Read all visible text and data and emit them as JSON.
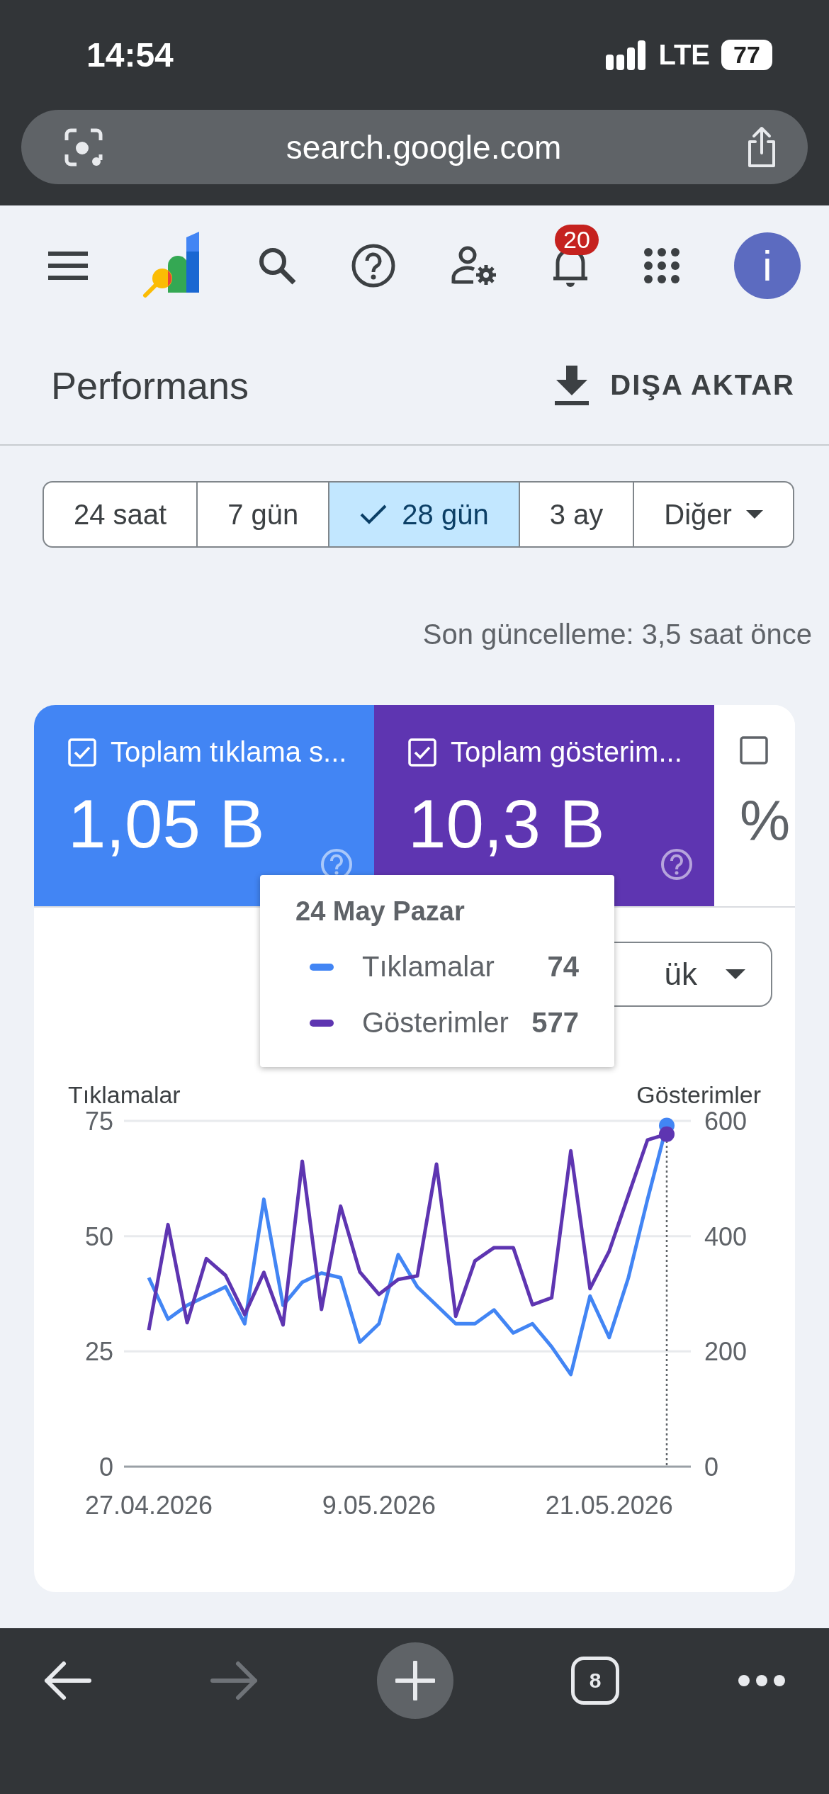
{
  "status_bar": {
    "time": "14:54",
    "network": "LTE",
    "battery": "77"
  },
  "browser": {
    "url": "search.google.com"
  },
  "header": {
    "notifications_badge": "20",
    "avatar_letter": "i"
  },
  "page": {
    "title": "Performans",
    "export_label": "DIŞA AKTAR"
  },
  "ranges": [
    {
      "label": "24 saat",
      "selected": false
    },
    {
      "label": "7 gün",
      "selected": false
    },
    {
      "label": "28 gün",
      "selected": true
    },
    {
      "label": "3 ay",
      "selected": false
    },
    {
      "label": "Diğer",
      "selected": false,
      "kind": "dropdown"
    }
  ],
  "last_update": "Son güncelleme: 3,5 saat önce",
  "metrics": [
    {
      "label": "Toplam tıklama s...",
      "value": "1,05 B",
      "checked": true,
      "color": "#4285f4"
    },
    {
      "label": "Toplam gösterim...",
      "value": "10,3 B",
      "checked": true,
      "color": "#5e35b1"
    },
    {
      "value": "%",
      "checked": false
    }
  ],
  "granularity_dropdown": {
    "value": "ük"
  },
  "tooltip": {
    "title": "24 May Pazar",
    "rows": [
      {
        "label": "Tıklamalar",
        "value": "74",
        "color": "#4285f4"
      },
      {
        "label": "Gösterimler",
        "value": "577",
        "color": "#5e35b1"
      }
    ]
  },
  "chart_data": {
    "type": "line",
    "ylabel": "Tıklamalar",
    "y2label": "Gösterimler",
    "categories": [
      "27.04.2026",
      null,
      null,
      null,
      null,
      null,
      null,
      null,
      null,
      null,
      null,
      null,
      "9.05.2026",
      null,
      null,
      null,
      null,
      null,
      null,
      null,
      null,
      null,
      null,
      null,
      "21.05.2026",
      null,
      null,
      null
    ],
    "ylim": [
      0,
      75
    ],
    "yticks": [
      0,
      25,
      50,
      75
    ],
    "y2lim": [
      0,
      600
    ],
    "y2ticks": [
      0,
      200,
      400,
      600
    ],
    "series": [
      {
        "color": "#4285f4",
        "values": [
          41,
          32,
          35,
          37,
          39,
          31,
          58,
          35,
          40,
          42,
          41,
          27,
          31,
          46,
          39,
          35,
          31,
          31,
          34,
          29,
          31,
          26,
          20,
          37,
          28,
          41,
          58,
          74
        ]
      },
      {
        "color": "#5e35b1",
        "axis": "y2",
        "values": [
          237,
          420,
          250,
          361,
          332,
          264,
          337,
          246,
          530,
          273,
          452,
          338,
          299,
          325,
          331,
          525,
          261,
          357,
          380,
          380,
          281,
          293,
          548,
          309,
          374,
          471,
          567,
          577
        ]
      }
    ]
  },
  "bottom_bar": {
    "tabs_count": "8",
    "forward_disabled": true
  }
}
